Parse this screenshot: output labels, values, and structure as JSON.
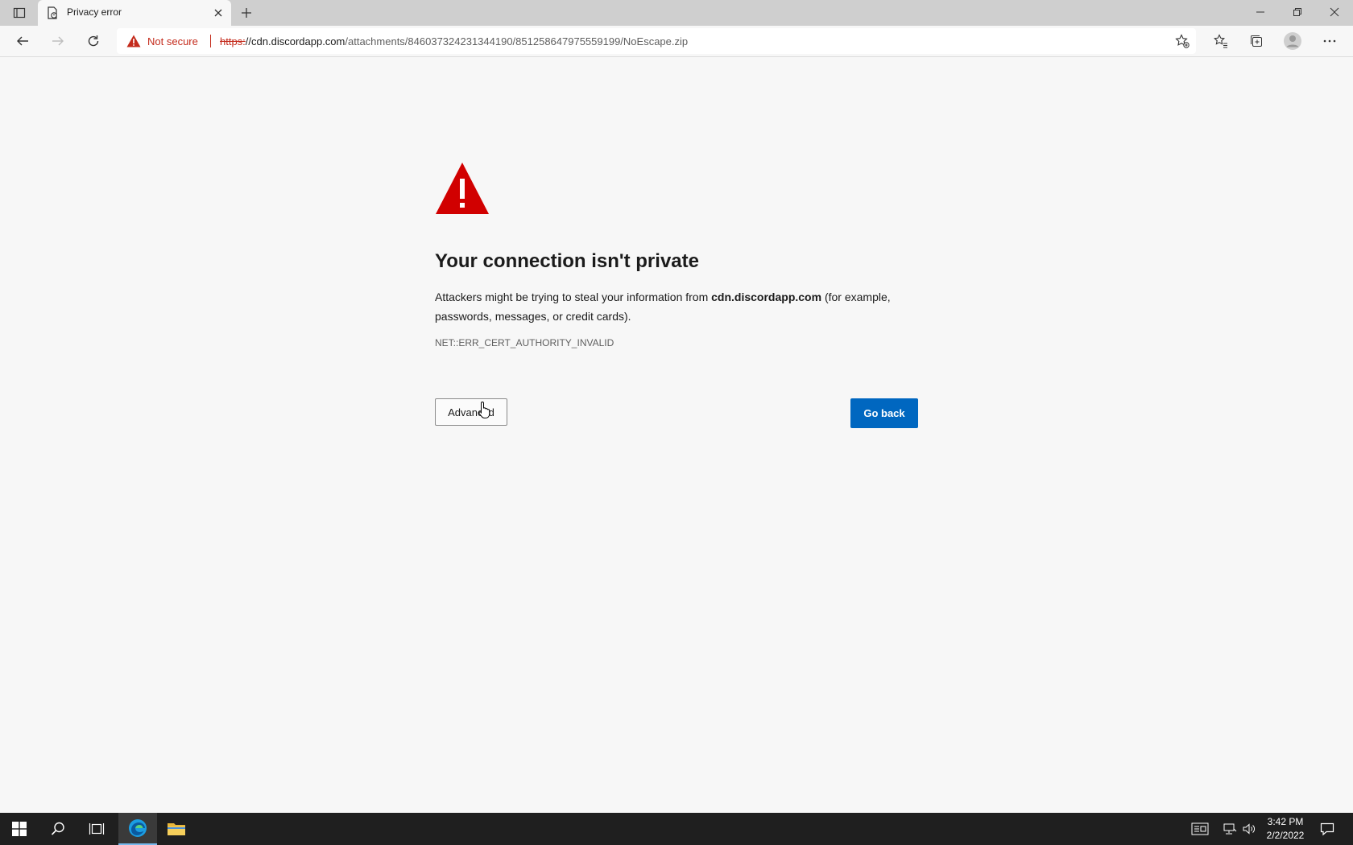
{
  "browser": {
    "tab": {
      "title": "Privacy error"
    },
    "address": {
      "security_label": "Not secure",
      "url_scheme": "https:",
      "url_host": "//cdn.discordapp.com",
      "url_path": "/attachments/846037324231344190/851258647975559199/NoEscape.zip"
    }
  },
  "page": {
    "heading": "Your connection isn't private",
    "desc_before": "Attackers might be trying to steal your information from ",
    "desc_host": "cdn.discordapp.com",
    "desc_after": " (for example, passwords, messages, or credit cards).",
    "error_code": "NET::ERR_CERT_AUTHORITY_INVALID",
    "advanced_label": "Advanced",
    "go_back_label": "Go back"
  },
  "colors": {
    "accent": "#0067c0",
    "danger": "#c42b1c",
    "warning_triangle": "#d10000"
  },
  "taskbar": {
    "time": "3:42 PM",
    "date": "2/2/2022"
  }
}
